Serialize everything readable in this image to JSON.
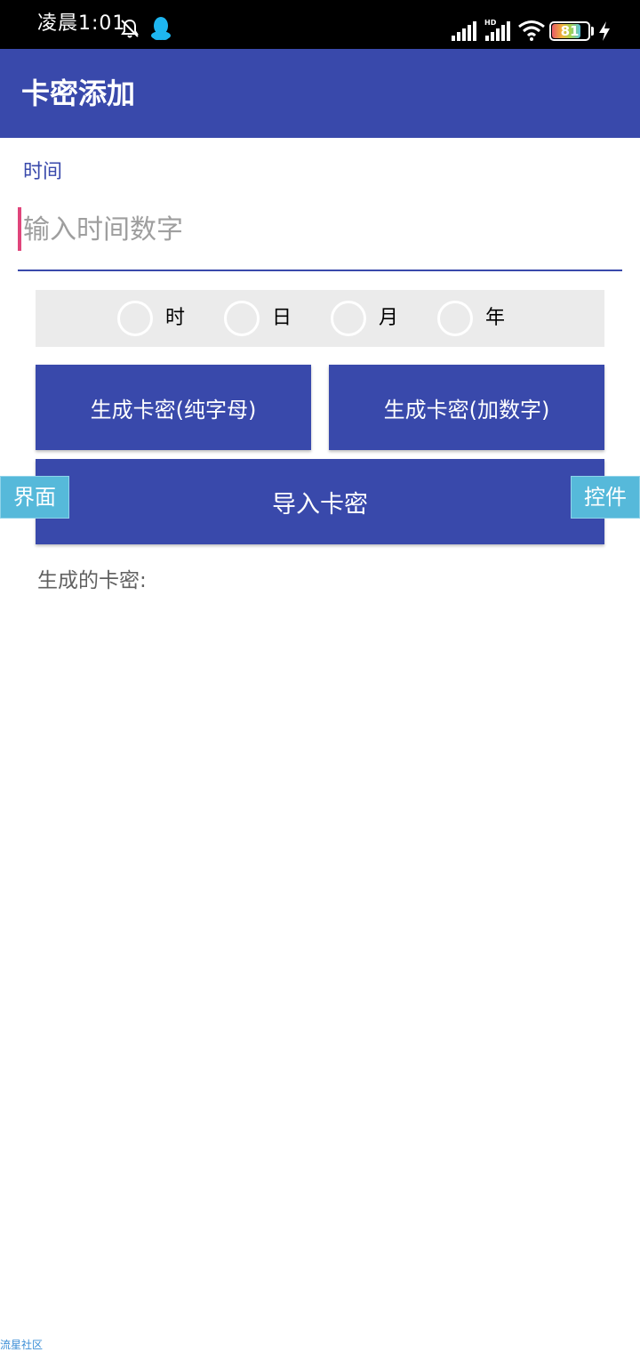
{
  "status_bar": {
    "time": "凌晨1:01",
    "battery_level": "81",
    "battery_fraction": 0.81,
    "icons": [
      "bell-off-icon",
      "qq-icon",
      "signal-icon",
      "hd-signal-icon",
      "wifi-icon",
      "battery-icon",
      "charging-icon"
    ]
  },
  "app_bar": {
    "title": "卡密添加"
  },
  "time_field": {
    "label": "时间",
    "value": "",
    "placeholder": "输入时间数字"
  },
  "unit_options": [
    {
      "label": "时",
      "selected": false
    },
    {
      "label": "日",
      "selected": false
    },
    {
      "label": "月",
      "selected": false
    },
    {
      "label": "年",
      "selected": false
    }
  ],
  "buttons": {
    "generate_letters": "生成卡密(纯字母)",
    "generate_digits": "生成卡密(加数字)",
    "import": "导入卡密"
  },
  "side_tabs": {
    "left": "界面",
    "right": "控件"
  },
  "result": {
    "label": "生成的卡密:"
  },
  "watermark": "流星社区",
  "colors": {
    "primary": "#3949ab",
    "accent": "#e0457b",
    "side_tab": "#56b9da",
    "radio_group_bg": "#ebebeb"
  }
}
